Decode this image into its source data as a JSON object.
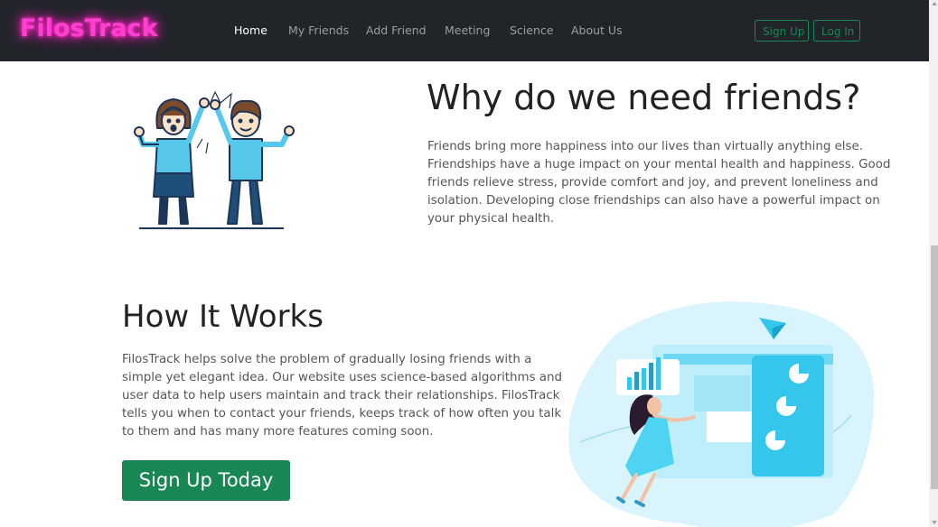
{
  "brand": "FilosTrack",
  "nav": {
    "links": [
      "Home",
      "My Friends",
      "Add Friend",
      "Meeting",
      "Science",
      "About Us"
    ],
    "signup": "Sign Up",
    "login": "Log In"
  },
  "why": {
    "title": "Why do we need friends?",
    "text": "Friends bring more happiness into our lives than virtually anything else. Friendships have a huge impact on your mental health and happiness. Good friends relieve stress, provide comfort and joy, and prevent loneliness and isolation. Developing close friendships can also have a powerful impact on your physical health."
  },
  "how": {
    "title": "How It Works",
    "text": "FilosTrack helps solve the problem of gradually losing friends with a simple yet elegant idea. Our website uses science-based algorithms and user data to help users maintain and track their relationships. FilosTrack tells you when to contact your friends, keeps track of how often you talk to them and has many more features coming soon.",
    "cta": "Sign Up Today"
  },
  "colors": {
    "navbar": "#212529",
    "brand_neon": "#ff3fd0",
    "accent_green": "#198754",
    "illustration_blue": "#4dd0f0"
  }
}
